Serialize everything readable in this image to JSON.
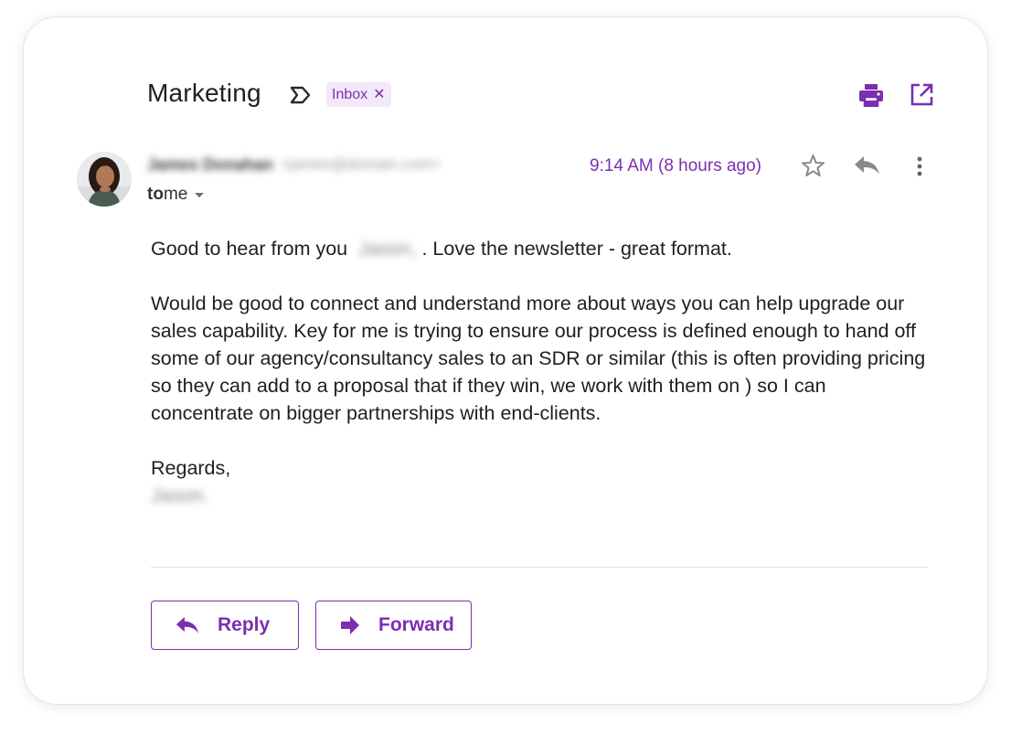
{
  "email": {
    "subject": "Marketing",
    "label": "Inbox",
    "label_remove": "✕",
    "importance_icon": "importance-marker-icon",
    "sender_name": "James Donahan",
    "sender_email": "<james@domain.com>",
    "to_prefix": "to",
    "to_value": "me",
    "time": "9:14 AM (8 hours ago)",
    "body": {
      "p1_before": "Good to hear from you",
      "p1_name": "Jason,",
      "p1_after": ". Love the newsletter - great format.",
      "p2": "Would be good to connect and understand more about ways you can help upgrade our sales capability. Key for me is trying to ensure our process is defined enough to hand off some of our agency/consultancy sales to an SDR or similar (this is often providing pricing so they can add to a proposal that if they win, we work with them on ) so I can concentrate on bigger partnerships with end-clients.",
      "closing": "Regards,",
      "signature": "Jason."
    }
  },
  "actions": {
    "reply_label": "Reply",
    "forward_label": "Forward"
  },
  "colors": {
    "accent": "#7b2fb0",
    "chip_bg": "#f2e8fa",
    "icon_gray": "#8a8a8a"
  }
}
